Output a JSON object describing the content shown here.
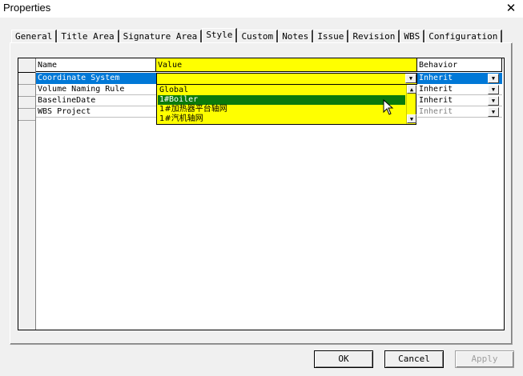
{
  "window": {
    "title": "Properties",
    "close_glyph": "✕"
  },
  "tabs": [
    {
      "label": "General"
    },
    {
      "label": "Title Area"
    },
    {
      "label": "Signature Area"
    },
    {
      "label": "Style"
    },
    {
      "label": "Custom"
    },
    {
      "label": "Notes"
    },
    {
      "label": "Issue"
    },
    {
      "label": "Revision"
    },
    {
      "label": "WBS"
    },
    {
      "label": "Configuration"
    }
  ],
  "active_tab": "Style",
  "table": {
    "headers": {
      "name": "Name",
      "value": "Value",
      "behavior": "Behavior"
    },
    "rows": [
      {
        "name": "Coordinate System",
        "value": "",
        "behavior": "Inherit"
      },
      {
        "name": "Volume Naming Rule",
        "value": "",
        "behavior": "Inherit"
      },
      {
        "name": "BaselineDate",
        "value": "",
        "behavior": "Inherit"
      },
      {
        "name": "WBS Project",
        "value": "",
        "behavior": "Inherit"
      }
    ]
  },
  "dropdown": {
    "options": [
      "Global",
      "1#Boiler",
      "1#加热器平台轴网",
      "1#汽机轴网"
    ],
    "selected_index": 1
  },
  "buttons": {
    "ok": "OK",
    "cancel": "Cancel",
    "apply": "Apply"
  },
  "colors": {
    "selection_blue": "#0078d7",
    "highlight_yellow": "#ffff00",
    "option_selected": "#0b7a0b"
  }
}
